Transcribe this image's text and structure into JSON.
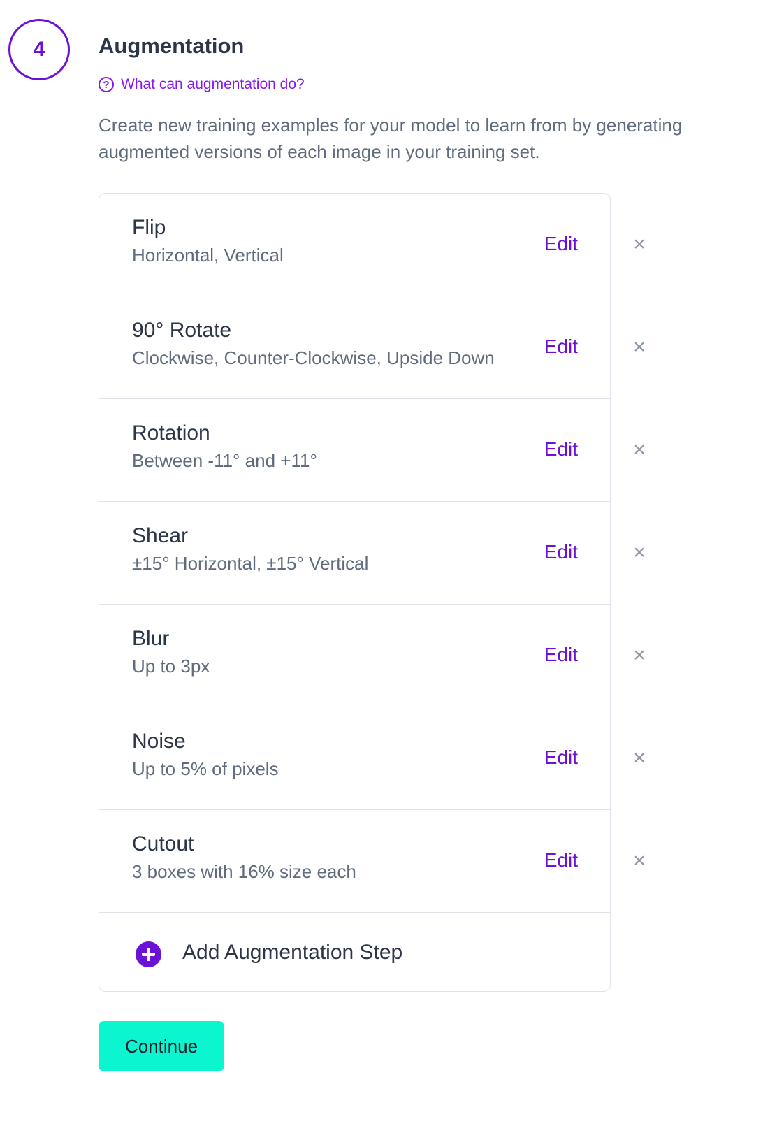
{
  "step": {
    "number": "4",
    "title": "Augmentation",
    "help_link": "What can augmentation do?",
    "help_icon": "question-circle-icon",
    "description_line1": "Create new training examples for your model to learn from by generating",
    "description_line2": "augmented versions of each image in your training set."
  },
  "augmentations": [
    {
      "name": "Flip",
      "detail": "Horizontal, Vertical",
      "edit_label": "Edit",
      "remove_label": "×"
    },
    {
      "name": "90° Rotate",
      "detail": "Clockwise, Counter-Clockwise, Upside Down",
      "edit_label": "Edit",
      "remove_label": "×"
    },
    {
      "name": "Rotation",
      "detail": "Between -11° and +11°",
      "edit_label": "Edit",
      "remove_label": "×"
    },
    {
      "name": "Shear",
      "detail": "±15° Horizontal, ±15° Vertical",
      "edit_label": "Edit",
      "remove_label": "×"
    },
    {
      "name": "Blur",
      "detail": "Up to 3px",
      "edit_label": "Edit",
      "remove_label": "×"
    },
    {
      "name": "Noise",
      "detail": "Up to 5% of pixels",
      "edit_label": "Edit",
      "remove_label": "×"
    },
    {
      "name": "Cutout",
      "detail": "3 boxes with 16% size each",
      "edit_label": "Edit",
      "remove_label": "×"
    }
  ],
  "add_step": {
    "label": "Add Augmentation Step",
    "icon": "plus-circle-icon"
  },
  "continue_label": "Continue",
  "colors": {
    "accent": "#6b12d6",
    "link": "#8a17f0",
    "continue_bg": "#0bf5d0",
    "text": "#2d3648",
    "muted_text": "#606b7d",
    "border": "#dfe2e8"
  }
}
